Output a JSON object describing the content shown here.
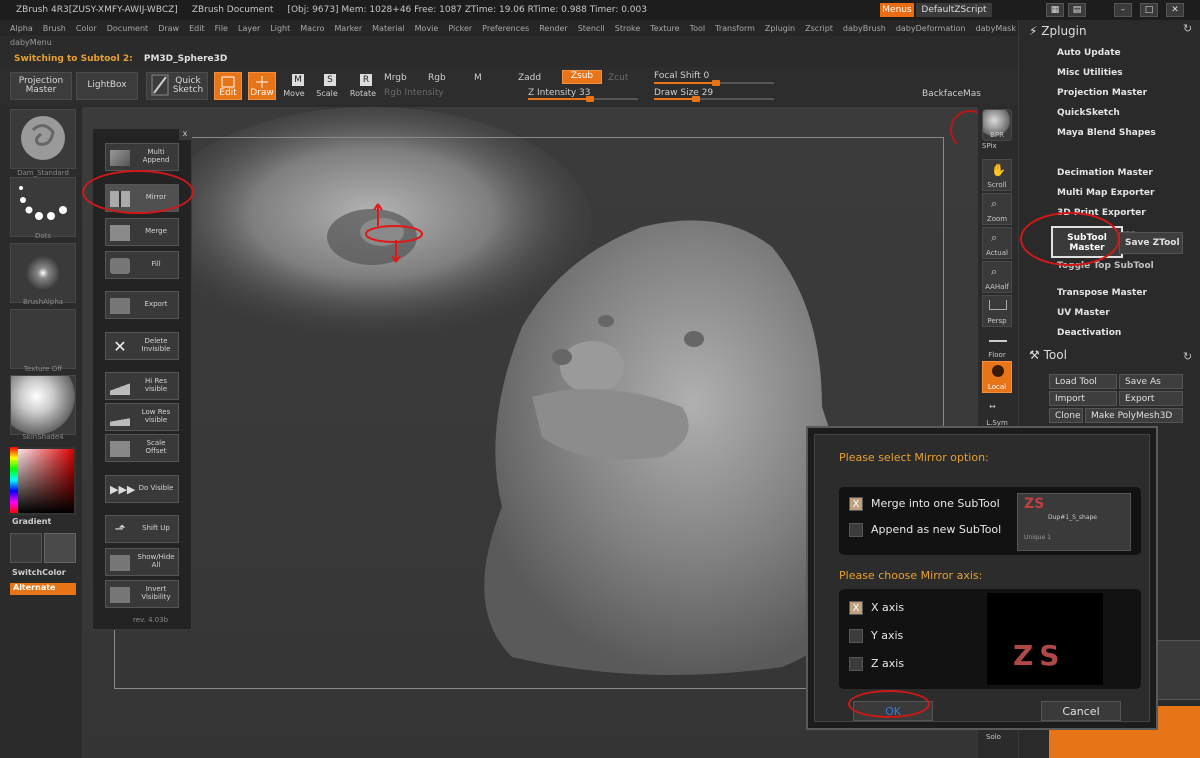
{
  "titlebar": {
    "app": "ZBrush 4R3[ZUSY-XMFY-AWIJ-WBCZ]",
    "doc": "ZBrush Document",
    "stats": "[Obj: 9673] Mem: 1028+46 Free: 1087 ZTime: 19.06 RTime: 0.988 Timer: 0.003",
    "menus": "Menus",
    "zscript": "DefaultZScript"
  },
  "menubar": [
    "Alpha",
    "Brush",
    "Color",
    "Document",
    "Draw",
    "Edit",
    "File",
    "Layer",
    "Light",
    "Macro",
    "Marker",
    "Material",
    "Movie",
    "Picker",
    "Preferences",
    "Render",
    "Stencil",
    "Stroke",
    "Texture",
    "Tool",
    "Transform",
    "Zplugin",
    "Zscript",
    "dabyBrush",
    "dabyDeformation",
    "dabyMask"
  ],
  "dabymenu": "dabyMenu",
  "status": {
    "label": "Switching to Subtool 2:",
    "value": "PM3D_Sphere3D"
  },
  "toolbar": {
    "projection_master": "Projection Master",
    "lightbox": "LightBox",
    "quick_sketch": "Quick Sketch",
    "edit": "Edit",
    "draw": "Draw",
    "move": "Move",
    "scale": "Scale",
    "rotate": "Rotate",
    "mrgb": "Mrgb",
    "rgb": "Rgb",
    "m": "M",
    "rgb_intensity": "Rgb Intensity",
    "zadd": "Zadd",
    "zsub": "Zsub",
    "zcut": "Zcut",
    "z_intensity": "Z Intensity 33",
    "focal_shift": "Focal Shift 0",
    "draw_size": "Draw Size 29",
    "backface": "BackfaceMas"
  },
  "left_shelf": {
    "brush": "Dam_Standard",
    "stroke": "Dots",
    "alpha": "BrushAlpha",
    "texture": "Texture Off",
    "material": "SkinShade4",
    "gradient": "Gradient",
    "switchcolor": "SwitchColor",
    "alternate": "Alternate"
  },
  "subtool_palette": {
    "close": "x",
    "items": [
      {
        "label": "Multi Append"
      },
      {
        "label": "Mirror"
      },
      {
        "label": "Merge"
      },
      {
        "label": "Fill"
      },
      {
        "label": "Export"
      },
      {
        "label": "Delete Invisible"
      },
      {
        "label": "Hi Res visible"
      },
      {
        "label": "Low Res visible"
      },
      {
        "label": "Scale Offset"
      },
      {
        "label": "Do Visible"
      },
      {
        "label": "Shift Up"
      },
      {
        "label": "Show/Hide All"
      },
      {
        "label": "Invert Visibility"
      }
    ],
    "version": "rev. 4.03b"
  },
  "right_shelf": [
    "BPR",
    "SPix",
    "Scroll",
    "Zoom",
    "Actual",
    "AAHalf",
    "Persp",
    "Floor",
    "Local",
    "L.Sym",
    "Solo"
  ],
  "zplugin": {
    "title": "Zplugin",
    "items": [
      "Auto Update",
      "Misc Utilities",
      "Projection Master",
      "QuickSketch",
      "Maya Blend Shapes",
      "Decimation Master",
      "Multi Map Exporter",
      "3D Print Exporter",
      "SubTool Master"
    ],
    "subtool_master_btn": "SubTool Master",
    "save_ztool": "Save ZTool",
    "toggle_top": "Toggle Top SubTool",
    "items2": [
      "Transpose Master",
      "UV Master",
      "Deactivation"
    ]
  },
  "tool": {
    "title": "Tool",
    "load_tool": "Load Tool",
    "save_as": "Save As",
    "import": "Import",
    "export": "Export",
    "clone": "Clone",
    "make_polymesh": "Make PolyMesh3D"
  },
  "dialog": {
    "mirror_option_label": "Please select Mirror option:",
    "merge": "Merge into one SubTool",
    "append": "Append as new SubTool",
    "axis_label": "Please choose Mirror axis:",
    "x_axis": "X axis",
    "y_axis": "Y axis",
    "z_axis": "Z axis",
    "ok": "OK",
    "cancel": "Cancel",
    "preview_text": "ZS",
    "preview_sub": "Dup#1_S_shape",
    "preview_sub2": "Unique 1"
  }
}
